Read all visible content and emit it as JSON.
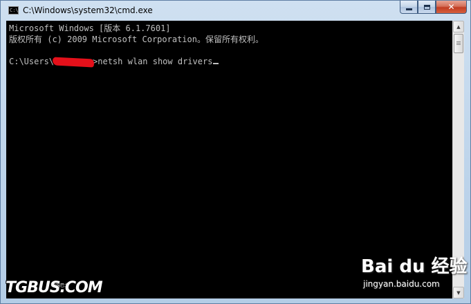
{
  "window": {
    "title": "C:\\Windows\\system32\\cmd.exe",
    "icon": "cmd-icon",
    "icon_text": "C:\\"
  },
  "caption_buttons": {
    "minimize_icon": "minimize-icon",
    "maximize_icon": "maximize-icon",
    "close_icon": "close-icon",
    "close_glyph": "✕"
  },
  "console": {
    "line1": "Microsoft Windows [版本 6.1.7601]",
    "line2": "版权所有 (c) 2009 Microsoft Corporation。保留所有权利。",
    "prompt_prefix": "C:\\Users\\",
    "prompt_suffix": ">netsh wlan show drivers",
    "text_color": "#c0c0c0",
    "background": "#000000"
  },
  "scrollbar": {
    "up_glyph": "▲",
    "down_glyph": "▼"
  },
  "watermarks": {
    "tgbus": "TGBUS.COM",
    "tgbus_sub": "电玩巴士",
    "baidu": "Bai du 经验",
    "baidu_url": "jingyan.baidu.com"
  }
}
